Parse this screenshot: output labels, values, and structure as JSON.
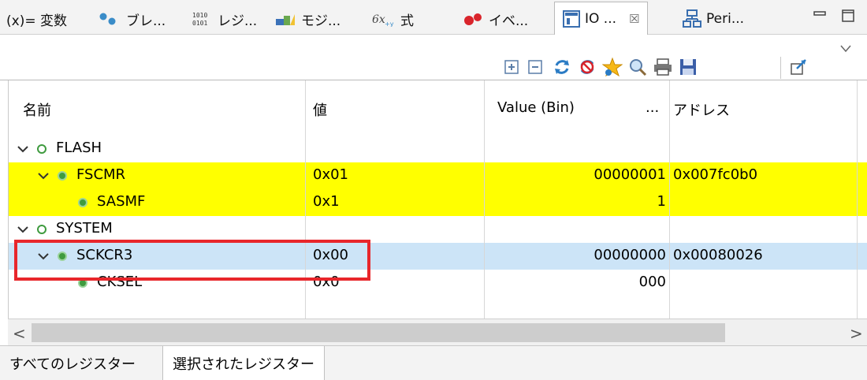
{
  "tabs": [
    {
      "label": "(x)= 変数",
      "icon": "variables-icon"
    },
    {
      "label": "ブレ...",
      "icon": "breakpoints-icon"
    },
    {
      "label": "レジ...",
      "icon": "registers-icon"
    },
    {
      "label": "モジ...",
      "icon": "modules-icon"
    },
    {
      "label": "式",
      "icon": "expressions-icon"
    },
    {
      "label": "イベ...",
      "icon": "events-icon"
    },
    {
      "label": "IO ...",
      "icon": "io-registers-icon",
      "active": true
    },
    {
      "label": "Peri...",
      "icon": "peripherals-icon"
    }
  ],
  "active_tab_close": "☒",
  "table": {
    "columns": [
      "名前",
      "値",
      "Value (Bin)",
      "...",
      "アドレス"
    ],
    "rows": [
      {
        "name": "FLASH",
        "value": "",
        "bin": "",
        "address": "",
        "level": 0,
        "expand": "expanded",
        "dot": "hollow",
        "highlight": "none"
      },
      {
        "name": "FSCMR",
        "value": "0x01",
        "bin": "00000001",
        "address": "0x007fc0b0",
        "level": 1,
        "expand": "expanded",
        "dot": "filled",
        "highlight": "yellow"
      },
      {
        "name": "SASMF",
        "value": "0x1",
        "bin": "1",
        "address": "",
        "level": 2,
        "expand": "none",
        "dot": "filled",
        "highlight": "yellow"
      },
      {
        "name": "SYSTEM",
        "value": "",
        "bin": "",
        "address": "",
        "level": 0,
        "expand": "expanded",
        "dot": "hollow",
        "highlight": "none"
      },
      {
        "name": "SCKCR3",
        "value": "0x00",
        "bin": "00000000",
        "address": "0x00080026",
        "level": 1,
        "expand": "expanded",
        "dot": "filled",
        "highlight": "selected"
      },
      {
        "name": "CKSEL",
        "value": "0x0",
        "bin": "000",
        "address": "",
        "level": 2,
        "expand": "none",
        "dot": "filled",
        "highlight": "none"
      }
    ]
  },
  "bottom_tabs": [
    "すべてのレジスター",
    "選択されたレジスター"
  ],
  "active_bottom_tab": 1,
  "toolbar_icons": [
    "expand-all-icon",
    "collapse-all-icon",
    "refresh-icon",
    "disable-refresh-icon",
    "favorite-icon",
    "search-icon",
    "print-icon",
    "save-icon",
    "pin-icon",
    "view-menu-icon"
  ],
  "colors": {
    "yellow_highlight": "#ffff00",
    "selected_row": "#cce4f7",
    "red_box": "#e8262b",
    "tree_dot": "#3f9b3f"
  },
  "scroll_arrows": {
    "left": "<",
    "right": ">"
  }
}
